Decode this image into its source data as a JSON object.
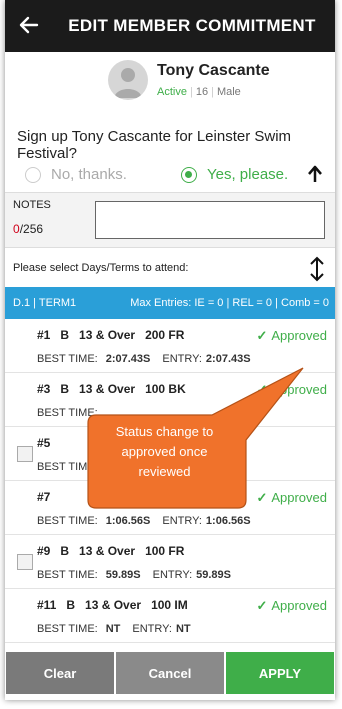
{
  "header": {
    "title": "EDIT MEMBER COMMITMENT"
  },
  "profile": {
    "name": "Tony Cascante",
    "status": "Active",
    "age": "16",
    "gender": "Male"
  },
  "question": "Sign up Tony Cascante for Leinster Swim Festival?",
  "choices": {
    "no": "No, thanks.",
    "yes": "Yes, please.",
    "selected": "yes"
  },
  "notes": {
    "label": "NOTES",
    "count": "0",
    "max": "/256",
    "value": ""
  },
  "select_label": "Please select Days/Terms to attend:",
  "term": {
    "left": "D.1 | TERM1",
    "right": "Max Entries: IE = 0 | REL = 0 | Comb = 0"
  },
  "labels": {
    "best": "BEST TIME:",
    "entry": "ENTRY:"
  },
  "events": [
    {
      "num": "#1",
      "gender": "B",
      "age": "13 & Over",
      "event": "200 FR",
      "best": "2:07.43S",
      "entry": "2:07.43S",
      "status": "Approved"
    },
    {
      "num": "#3",
      "gender": "B",
      "age": "13 & Over",
      "event": "100 BK",
      "best": "",
      "entry": "",
      "status": "Approved"
    },
    {
      "num": "#5",
      "gender": "",
      "age": "",
      "event": "",
      "best": "",
      "entry": "",
      "status": ""
    },
    {
      "num": "#7",
      "gender": "",
      "age": "",
      "event": "",
      "best": "1:06.56S",
      "entry": "1:06.56S",
      "status": "Approved"
    },
    {
      "num": "#9",
      "gender": "B",
      "age": "13 & Over",
      "event": "100 FR",
      "best": "59.89S",
      "entry": "59.89S",
      "status": ""
    },
    {
      "num": "#11",
      "gender": "B",
      "age": "13 & Over",
      "event": "100 IM",
      "best": "NT",
      "entry": "NT",
      "status": "Approved"
    }
  ],
  "callout": {
    "line1": "Status change to",
    "line2": "approved once",
    "line3": "reviewed"
  },
  "footer": {
    "clear": "Clear",
    "cancel": "Cancel",
    "apply": "APPLY"
  },
  "colors": {
    "accent": "#2a9fd8",
    "green": "#3fae49",
    "callout": "#f0722b",
    "header": "#1b1b1b"
  }
}
